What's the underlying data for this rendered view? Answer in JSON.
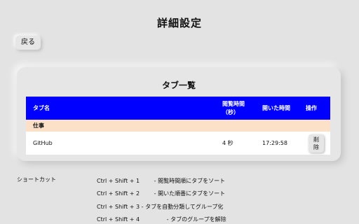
{
  "page": {
    "title": "詳細設定",
    "back_label": "戻る"
  },
  "tab_list": {
    "title": "タブ一覧",
    "headers": {
      "name": "タブ名",
      "view_time": "閲覧時間（秒）",
      "opened_at": "開いた時間",
      "actions": "操作"
    },
    "groups": [
      {
        "name": "仕事",
        "rows": [
          {
            "name": "GitHub",
            "view_time": "4 秒",
            "opened_at": "17:29:58",
            "action_label": "削除"
          }
        ]
      }
    ]
  },
  "shortcuts": {
    "label": "ショートカット",
    "items": [
      {
        "keys": "Ctrl + Shift + 1",
        "desc": "- 閲覧時間順にタブをソート"
      },
      {
        "keys": "Ctrl + Shift + 2",
        "desc": "- 開いた順番にタブをソート"
      },
      {
        "keys": "Ctrl + Shift + 3",
        "desc": "- タブを自動分類してグループ化"
      },
      {
        "keys": "Ctrl + Shift + 4",
        "desc": "- タブのグループを解除"
      }
    ]
  }
}
